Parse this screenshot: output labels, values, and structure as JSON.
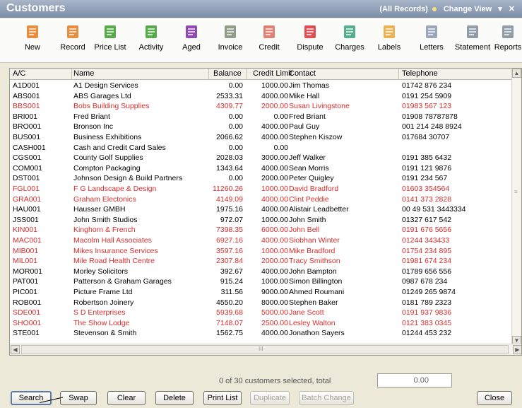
{
  "window": {
    "title": "Customers",
    "filter": "(All Records)",
    "change_view": "Change View",
    "close_glyph": "✕",
    "dropdown_glyph": "▾"
  },
  "toolbar": [
    {
      "label": "New",
      "icon": "new-customer-icon",
      "color": "#e07a1c"
    },
    {
      "label": "Record",
      "icon": "record-icon",
      "color": "#e07a1c"
    },
    {
      "label": "Price List",
      "icon": "price-list-icon",
      "color": "#3a9a2a"
    },
    {
      "label": "Activity",
      "icon": "activity-icon",
      "color": "#3a9a2a"
    },
    {
      "label": "Aged",
      "icon": "aged-icon",
      "color": "#7a2aa0"
    },
    {
      "label": "Invoice",
      "icon": "invoice-icon",
      "color": "#7d8b74"
    },
    {
      "label": "Credit",
      "icon": "credit-icon",
      "color": "#d96a5a"
    },
    {
      "label": "Dispute",
      "icon": "dispute-icon",
      "color": "#d9303a"
    },
    {
      "label": "Charges",
      "icon": "charges-icon",
      "color": "#3aa07a"
    },
    {
      "label": "Labels",
      "icon": "labels-icon",
      "color": "#e8a53a"
    },
    {
      "label": "Letters",
      "icon": "letters-icon",
      "color": "#8898b0"
    },
    {
      "label": "Statement",
      "icon": "statement-icon",
      "color": "#7d8b98"
    },
    {
      "label": "Reports",
      "icon": "reports-icon",
      "color": "#7d8b98"
    }
  ],
  "columns": {
    "ac": "A/C",
    "name": "Name",
    "balance": "Balance",
    "credit_limit": "Credit Limit",
    "contact": "Contact",
    "telephone": "Telephone"
  },
  "rows": [
    {
      "ac": "A1D001",
      "name": "A1 Design Services",
      "balance": "0.00",
      "limit": "1000.00",
      "contact": "Jim Thomas",
      "tel": "01742 876 234",
      "red": false
    },
    {
      "ac": "ABS001",
      "name": "ABS Garages Ltd",
      "balance": "2533.31",
      "limit": "4000.00",
      "contact": "Mike Hall",
      "tel": "0191 254 5909",
      "red": false
    },
    {
      "ac": "BBS001",
      "name": "Bobs Building Supplies",
      "balance": "4309.77",
      "limit": "2000.00",
      "contact": "Susan Livingstone",
      "tel": "01983 567 123",
      "red": true
    },
    {
      "ac": "BRI001",
      "name": "Fred Briant",
      "balance": "0.00",
      "limit": "0.00",
      "contact": "Fred Briant",
      "tel": "01908 78787878",
      "red": false
    },
    {
      "ac": "BRO001",
      "name": "Bronson Inc",
      "balance": "0.00",
      "limit": "4000.00",
      "contact": "Paul Guy",
      "tel": "001 214 248 8924",
      "red": false
    },
    {
      "ac": "BUS001",
      "name": "Business Exhibitions",
      "balance": "2066.62",
      "limit": "4000.00",
      "contact": "Stephen Kiszow",
      "tel": "017684 30707",
      "red": false
    },
    {
      "ac": "CASH001",
      "name": "Cash and Credit Card Sales",
      "balance": "0.00",
      "limit": "0.00",
      "contact": "",
      "tel": "",
      "red": false
    },
    {
      "ac": "CGS001",
      "name": "County Golf Supplies",
      "balance": "2028.03",
      "limit": "3000.00",
      "contact": "Jeff Walker",
      "tel": "0191 385 6432",
      "red": false
    },
    {
      "ac": "COM001",
      "name": "Compton Packaging",
      "balance": "1343.64",
      "limit": "4000.00",
      "contact": "Sean Morris",
      "tel": "0191 121 9876",
      "red": false
    },
    {
      "ac": "DST001",
      "name": "Johnson Design & Build Partners",
      "balance": "0.00",
      "limit": "2000.00",
      "contact": "Peter Quigley",
      "tel": "0191 234 567",
      "red": false
    },
    {
      "ac": "FGL001",
      "name": "F G Landscape & Design",
      "balance": "11260.26",
      "limit": "1000.00",
      "contact": "David Bradford",
      "tel": "01603 354564",
      "red": true
    },
    {
      "ac": "GRA001",
      "name": "Graham Electonics",
      "balance": "4149.09",
      "limit": "4000.00",
      "contact": "Clint Peddie",
      "tel": "0141 373 2828",
      "red": true
    },
    {
      "ac": "HAU001",
      "name": "Hausser GMBH",
      "balance": "1975.16",
      "limit": "4000.00",
      "contact": "Alistair Leadbetter",
      "tel": "00 49 531 3443334",
      "red": false
    },
    {
      "ac": "JSS001",
      "name": "John Smith Studios",
      "balance": "972.07",
      "limit": "1000.00",
      "contact": "John Smith",
      "tel": "01327 617 542",
      "red": false
    },
    {
      "ac": "KIN001",
      "name": "Kinghorn & French",
      "balance": "7398.35",
      "limit": "6000.00",
      "contact": "John Bell",
      "tel": "0191 676 5656",
      "red": true
    },
    {
      "ac": "MAC001",
      "name": "Macolm Hall Associates",
      "balance": "6927.16",
      "limit": "4000.00",
      "contact": "Siobhan Winter",
      "tel": "01244 343433",
      "red": true
    },
    {
      "ac": "MIB001",
      "name": "Mikes Insurance Services",
      "balance": "3597.16",
      "limit": "1000.00",
      "contact": "Mike Bradford",
      "tel": "01754 234 895",
      "red": true
    },
    {
      "ac": "MIL001",
      "name": "Mile Road Health Centre",
      "balance": "2307.84",
      "limit": "2000.00",
      "contact": "Tracy Smithson",
      "tel": "01981 674 234",
      "red": true
    },
    {
      "ac": "MOR001",
      "name": "Morley Solicitors",
      "balance": "392.67",
      "limit": "4000.00",
      "contact": "John Bampton",
      "tel": "01789 656 556",
      "red": false
    },
    {
      "ac": "PAT001",
      "name": "Patterson & Graham Garages",
      "balance": "915.24",
      "limit": "1000.00",
      "contact": "Simon Billington",
      "tel": "0987 678 234",
      "red": false
    },
    {
      "ac": "PIC001",
      "name": "Picture Frame Ltd",
      "balance": "311.56",
      "limit": "9000.00",
      "contact": "Ahmed Roumani",
      "tel": "01249 265 9874",
      "red": false
    },
    {
      "ac": "ROB001",
      "name": "Robertson Joinery",
      "balance": "4550.20",
      "limit": "8000.00",
      "contact": "Stephen Baker",
      "tel": "0181 789 2323",
      "red": false
    },
    {
      "ac": "SDE001",
      "name": "S D Enterprises",
      "balance": "5939.68",
      "limit": "5000.00",
      "contact": "Jane Scott",
      "tel": "0191 937 9836",
      "red": true
    },
    {
      "ac": "SHO001",
      "name": "The Show Lodge",
      "balance": "7148.07",
      "limit": "2500.00",
      "contact": "Lesley Walton",
      "tel": "0121 383 0345",
      "red": true
    },
    {
      "ac": "STE001",
      "name": "Stevenson & Smith",
      "balance": "1562.75",
      "limit": "4000.00",
      "contact": "Jonathon Sayers",
      "tel": "01244 453 232",
      "red": false
    }
  ],
  "status": {
    "selection_text": "0 of 30 customers selected, total",
    "total_value": "0.00"
  },
  "buttons": {
    "search": "Search",
    "swap": "Swap",
    "clear": "Clear",
    "delete": "Delete",
    "print_list": "Print List",
    "duplicate": "Duplicate",
    "batch_change": "Batch Change",
    "close": "Close"
  },
  "scroll": {
    "up": "▲",
    "down": "▼",
    "left": "◀",
    "right": "▶",
    "grip": "≡",
    "hgrip": "III"
  },
  "colors": {
    "overdue_red": "#d92b2b",
    "title_bar": "#8a9ab3"
  }
}
